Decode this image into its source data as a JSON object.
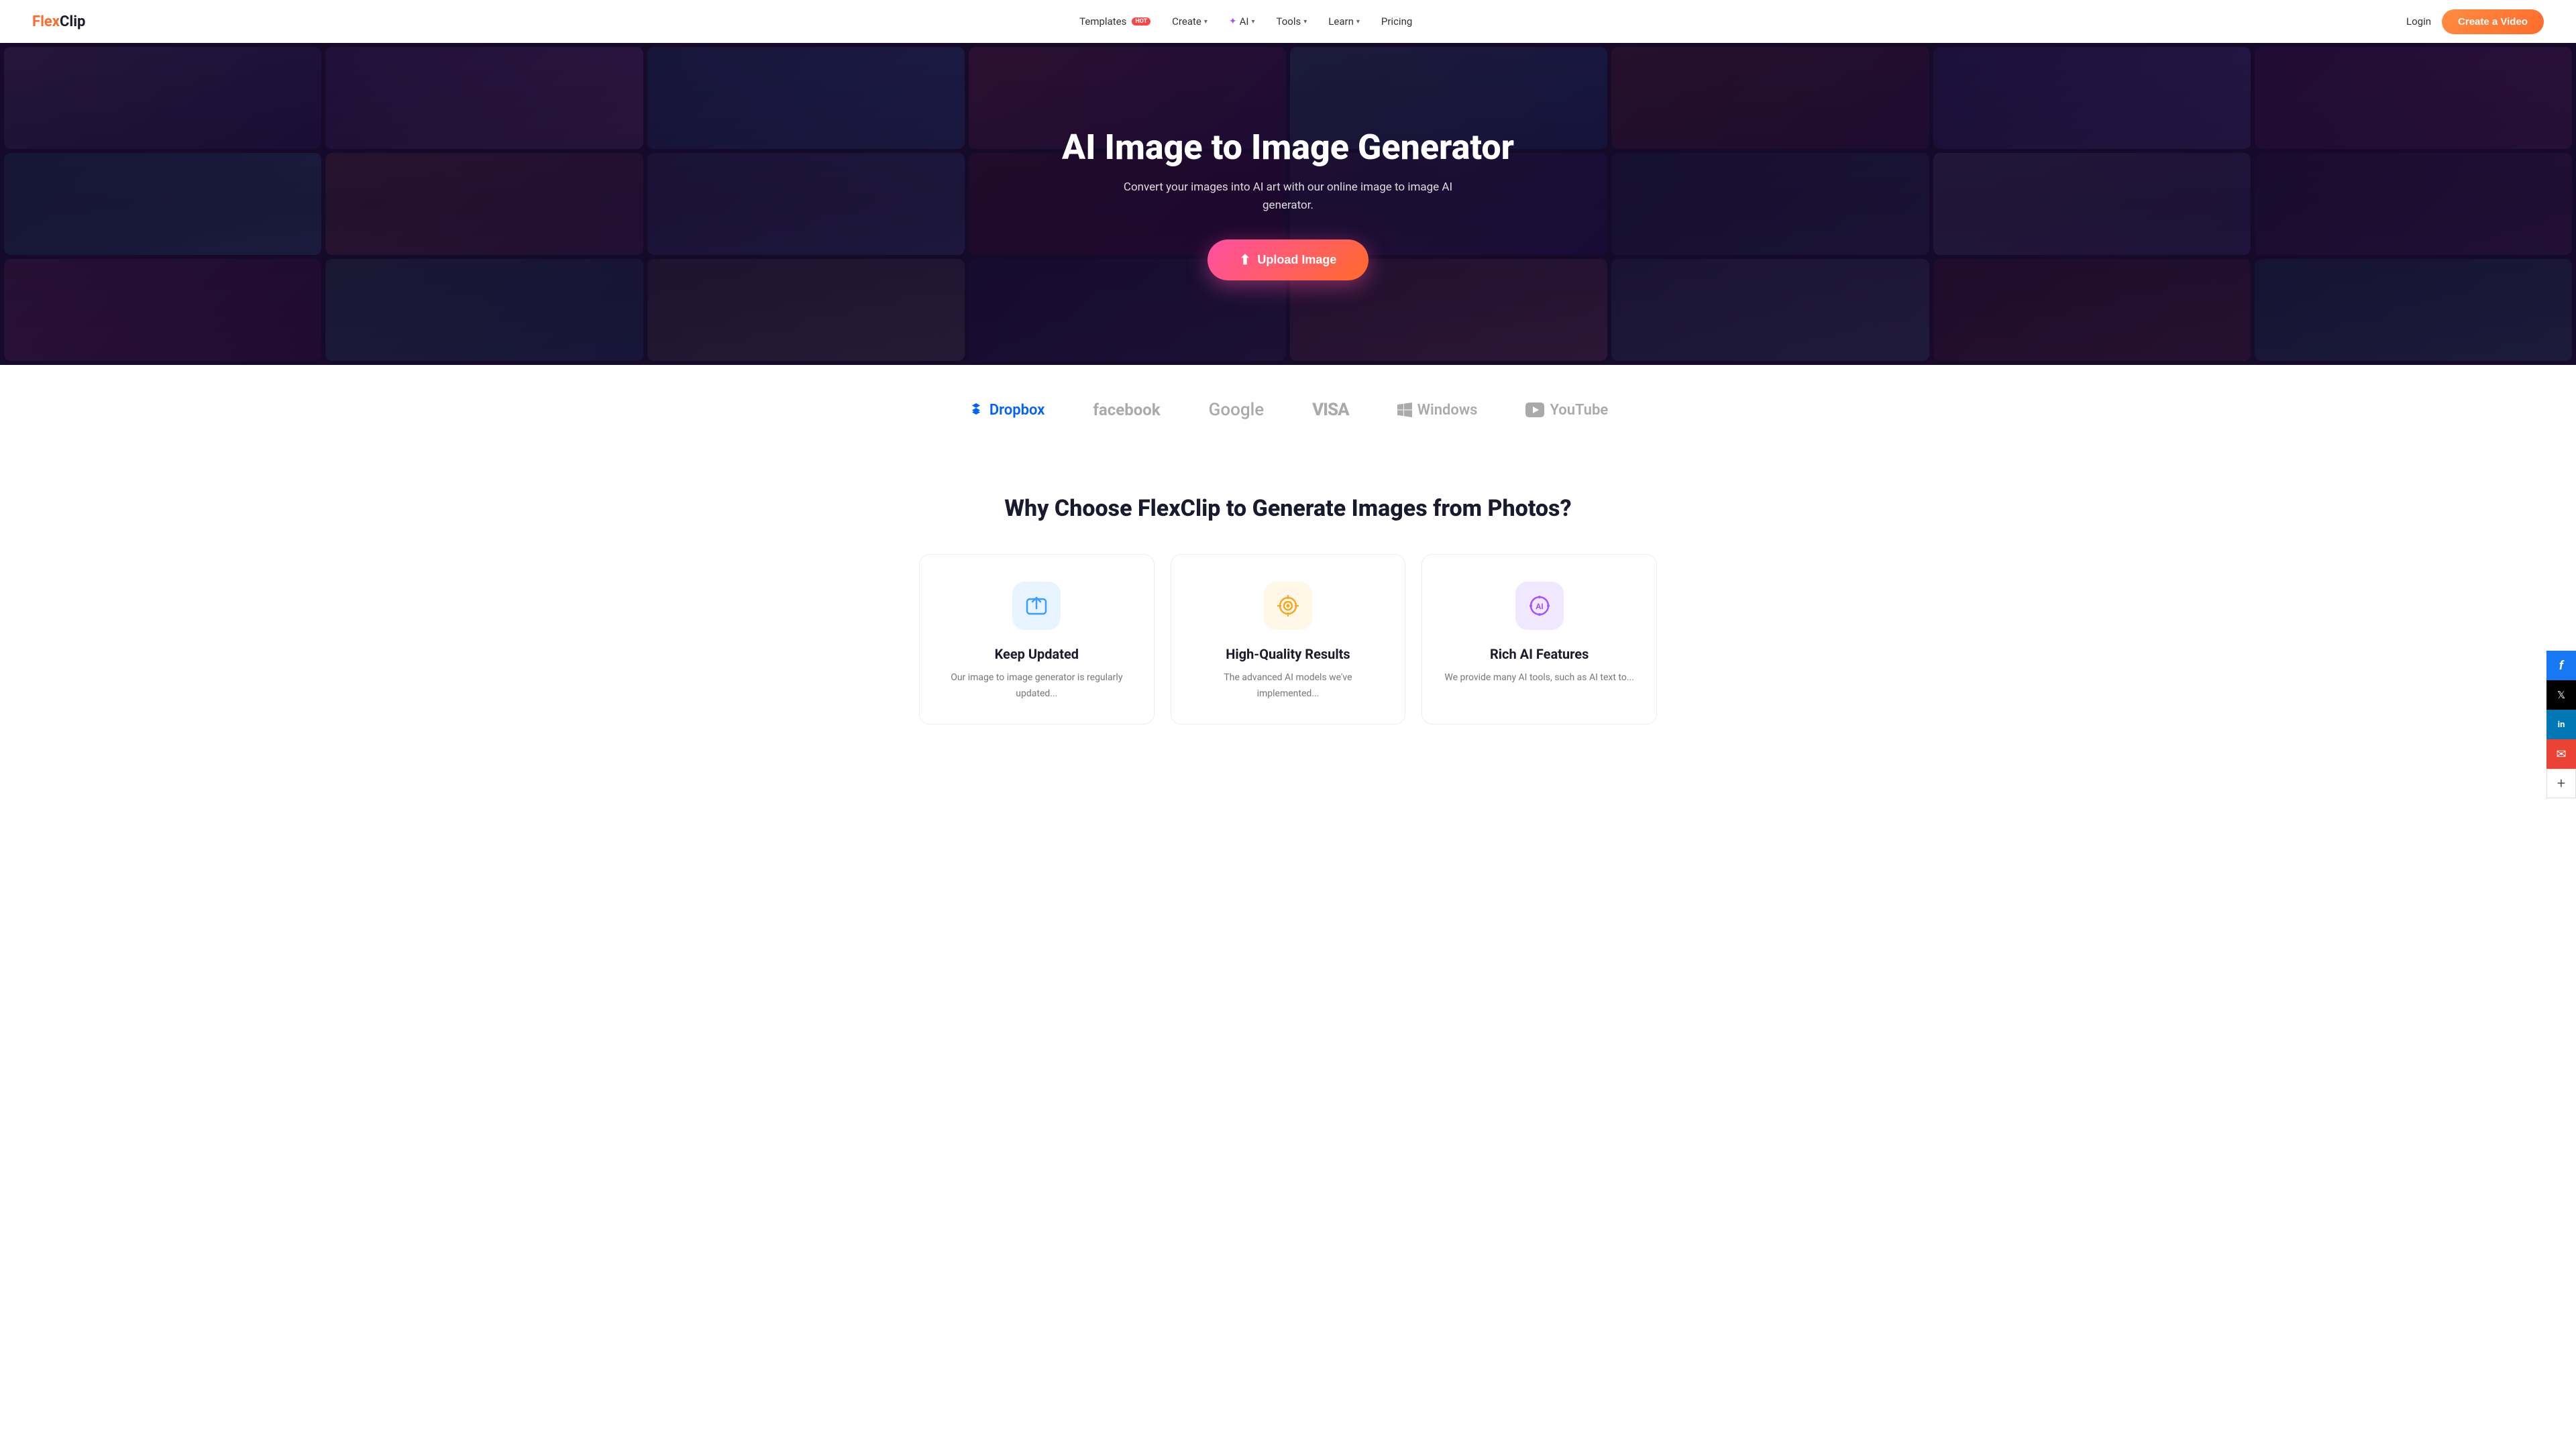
{
  "nav": {
    "logo_flex": "Flex",
    "logo_clip": "Clip",
    "links": [
      {
        "label": "Templates",
        "badge": "HOT",
        "hasDropdown": false
      },
      {
        "label": "Create",
        "hasDropdown": true
      },
      {
        "label": "AI",
        "hasDropdown": true,
        "isAI": true
      },
      {
        "label": "Tools",
        "hasDropdown": true
      },
      {
        "label": "Learn",
        "hasDropdown": true
      },
      {
        "label": "Pricing",
        "hasDropdown": false
      }
    ],
    "login_label": "Login",
    "cta_label": "Create a Video"
  },
  "hero": {
    "title": "AI Image to Image Generator",
    "subtitle": "Convert your images into AI art with our online image to image AI generator.",
    "upload_btn_label": "Upload Image"
  },
  "logos": [
    {
      "name": "Dropbox",
      "type": "dropbox"
    },
    {
      "name": "facebook",
      "type": "facebook"
    },
    {
      "name": "Google",
      "type": "google"
    },
    {
      "name": "VISA",
      "type": "visa"
    },
    {
      "name": "Windows",
      "type": "windows"
    },
    {
      "name": "YouTube",
      "type": "youtube"
    }
  ],
  "why_section": {
    "title": "Why Choose FlexClip to Generate Images from Photos?",
    "features": [
      {
        "id": "keep-updated",
        "title": "Keep Updated",
        "desc": "Our image to image generator is regularly updated...",
        "icon_type": "upload",
        "icon_color": "blue"
      },
      {
        "id": "high-quality",
        "title": "High-Quality Results",
        "desc": "The advanced AI models we've implemented...",
        "icon_type": "target",
        "icon_color": "yellow"
      },
      {
        "id": "rich-ai",
        "title": "Rich AI Features",
        "desc": "We provide many AI tools, such as AI text to...",
        "icon_type": "ai",
        "icon_color": "purple"
      }
    ]
  },
  "social": {
    "items": [
      {
        "name": "Facebook",
        "type": "fb",
        "symbol": "f"
      },
      {
        "name": "Twitter/X",
        "type": "tw",
        "symbol": "𝕏"
      },
      {
        "name": "LinkedIn",
        "type": "li",
        "symbol": "in"
      },
      {
        "name": "Email",
        "type": "em",
        "symbol": "✉"
      },
      {
        "name": "More",
        "type": "plus",
        "symbol": "+"
      }
    ]
  }
}
